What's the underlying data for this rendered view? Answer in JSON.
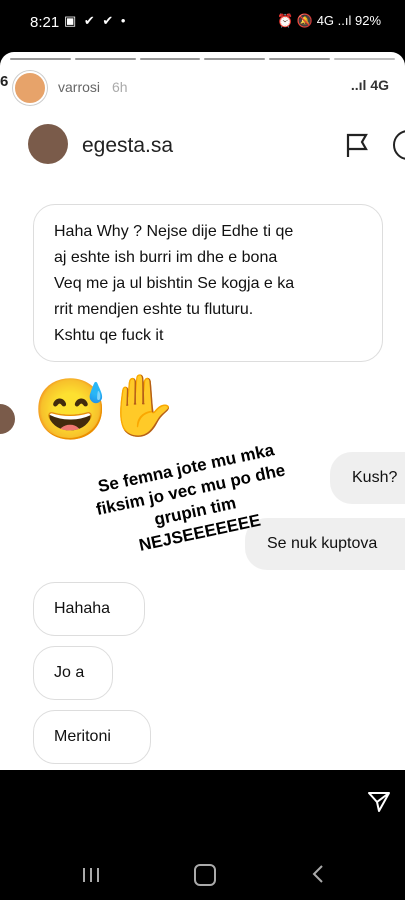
{
  "status": {
    "time": "8:21",
    "icons": "▣ ✔ ✔ •",
    "right": "⏰ 🔕 4G ..ıl 92%"
  },
  "story": {
    "count": "6",
    "user": "varrosi",
    "time": "6h",
    "signal": "..ıl 4G"
  },
  "chat": {
    "name": "egesta.sa",
    "incoming_long": "Haha Why ? Nejse dije Edhe ti qe\naj eshte ish burri im  dhe e bona\nVeq me ja ul bishtin Se kogja e ka\nrrit mendjen eshte tu fluturu.\nKshtu qe fuck it",
    "emojis": [
      "😅",
      "✋"
    ],
    "outgoing": [
      "Kush?",
      "Se nuk kuptova"
    ],
    "incoming_short": [
      "Hahaha",
      "Jo a",
      "Meritoni"
    ]
  },
  "overlay_text": "Se femna jote mu mka\nfiksim jo vec mu po dhe\ngrupin tim\nNEJSEEEEEEE"
}
